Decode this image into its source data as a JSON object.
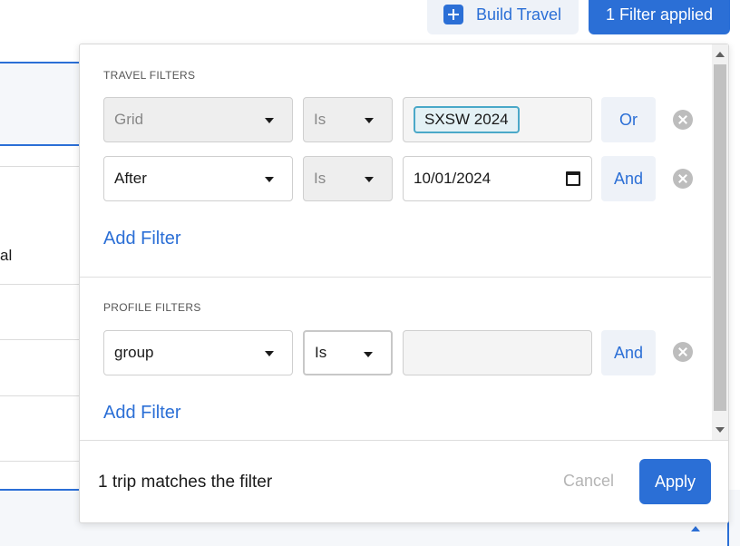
{
  "toolbar": {
    "build_travel_label": "Build Travel",
    "filter_applied_label": "1 Filter applied"
  },
  "background": {
    "partial_text": "al"
  },
  "filters": {
    "travel_section_label": "TRAVEL FILTERS",
    "profile_section_label": "PROFILE FILTERS",
    "add_filter_label": "Add Filter",
    "travel_rows": [
      {
        "field": "Grid",
        "operator": "Is",
        "value_tag": "SXSW 2024",
        "conjunction": "Or"
      },
      {
        "field": "After",
        "operator": "Is",
        "value": "10/01/2024",
        "conjunction": "And"
      }
    ],
    "profile_rows": [
      {
        "field": "group",
        "operator": "Is",
        "value": "",
        "conjunction": "And"
      }
    ]
  },
  "footer": {
    "match_text": "1 trip matches the filter",
    "cancel_label": "Cancel",
    "apply_label": "Apply"
  },
  "colors": {
    "accent": "#2b6fd6",
    "tag_border": "#4aa8c8",
    "muted": "#b5b5b5"
  }
}
